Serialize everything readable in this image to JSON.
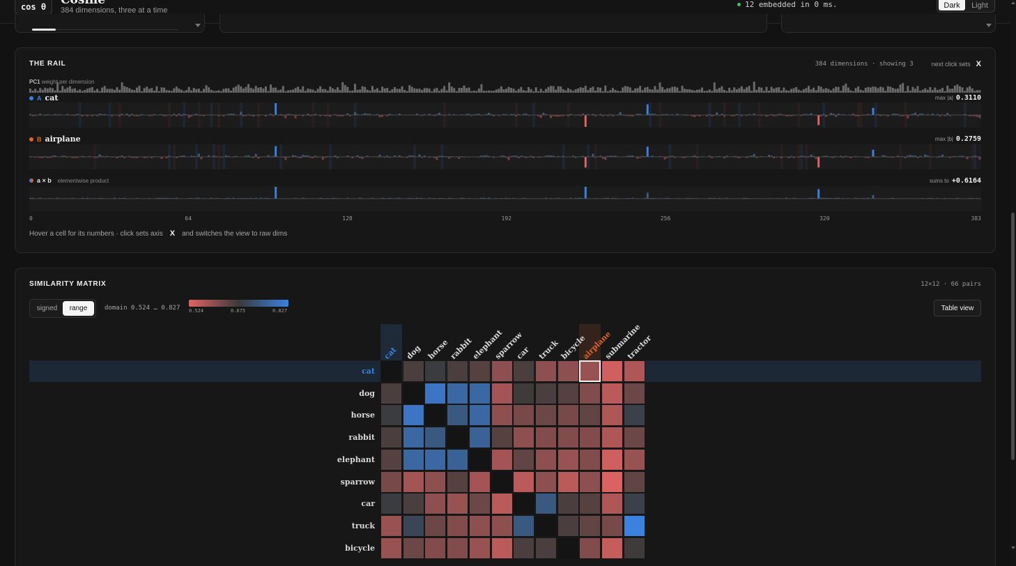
{
  "header": {
    "logo": "cos θ",
    "title": "Cosine",
    "subtitle": "384 dimensions, three at a time",
    "status": "12 embedded in 0 ms.",
    "theme_options": [
      "Dark",
      "Light"
    ],
    "theme_selected": "Dark"
  },
  "rail": {
    "title": "THE RAIL",
    "dimensions_text": "384 dimensions · showing 3",
    "next_click_text": "next click sets",
    "next_click_axis": "X",
    "pc1_label": "PC1",
    "pc1_sub": "weight per dimension",
    "tracks": [
      {
        "letter": "A",
        "word": "cat",
        "color": "#3b82e0",
        "stat_label": "max |a|",
        "stat_value": "0.3110"
      },
      {
        "letter": "B",
        "word": "airplane",
        "color": "#e0642a",
        "stat_label": "max |b|",
        "stat_value": "0.2759"
      },
      {
        "letter": "a × b",
        "word": "",
        "sub": "elementwise product",
        "color": "#9b5bd6",
        "stat_label": "sums to",
        "stat_value": "+0.6164"
      }
    ],
    "axis_ticks": [
      "0",
      "64",
      "128",
      "192",
      "256",
      "320",
      "383"
    ],
    "hint_before": "Hover a cell for its numbers · click sets axis",
    "hint_axis": "X",
    "hint_after": "and switches the view to raw dims"
  },
  "matrix": {
    "title": "SIMILARITY MATRIX",
    "meta": "12×12 · 66 pairs",
    "modes": [
      "signed",
      "range"
    ],
    "mode_selected": "range",
    "domain_text": "domain 0.524 … 0.827",
    "legend_ticks": [
      "0.524",
      "0.675",
      "0.827"
    ],
    "table_view_label": "Table view",
    "words": [
      "cat",
      "dog",
      "horse",
      "rabbit",
      "elephant",
      "sparrow",
      "car",
      "truck",
      "bicycle",
      "airplane",
      "submarine",
      "tractor"
    ],
    "visible_rows": 9,
    "selected_row": "cat",
    "selected_col": "airplane",
    "colors": {
      "low": "#e26464",
      "mid": "#3a3a3a",
      "high": "#3b82e0",
      "diag": "#141414",
      "word_a": "#3b82e0",
      "word_b": "#e0642a"
    },
    "values": [
      [
        null,
        0.66,
        0.68,
        0.66,
        0.65,
        0.6,
        0.66,
        0.6,
        0.6,
        0.59,
        0.54,
        0.57
      ],
      [
        0.66,
        null,
        0.8,
        0.77,
        0.77,
        0.58,
        0.67,
        0.66,
        0.65,
        0.61,
        0.56,
        0.63
      ],
      [
        0.68,
        0.8,
        null,
        0.74,
        0.77,
        0.6,
        0.62,
        0.63,
        0.62,
        0.64,
        0.57,
        0.69
      ],
      [
        0.66,
        0.77,
        0.74,
        null,
        0.76,
        0.65,
        0.6,
        0.61,
        0.61,
        0.61,
        0.57,
        0.63
      ],
      [
        0.65,
        0.77,
        0.77,
        0.76,
        null,
        0.58,
        0.64,
        0.6,
        0.59,
        0.61,
        0.54,
        0.59
      ],
      [
        0.62,
        0.58,
        0.6,
        0.65,
        0.58,
        null,
        0.56,
        0.6,
        0.56,
        0.6,
        0.53,
        0.64
      ],
      [
        0.68,
        0.66,
        0.6,
        0.59,
        0.63,
        0.56,
        null,
        0.74,
        0.66,
        0.65,
        0.57,
        0.69
      ],
      [
        0.59,
        0.7,
        0.63,
        0.61,
        0.6,
        0.6,
        0.74,
        null,
        0.66,
        0.64,
        0.62,
        0.83
      ],
      [
        0.59,
        0.63,
        0.61,
        0.61,
        0.59,
        0.56,
        0.66,
        0.66,
        null,
        0.61,
        0.55,
        0.67
      ]
    ]
  }
}
